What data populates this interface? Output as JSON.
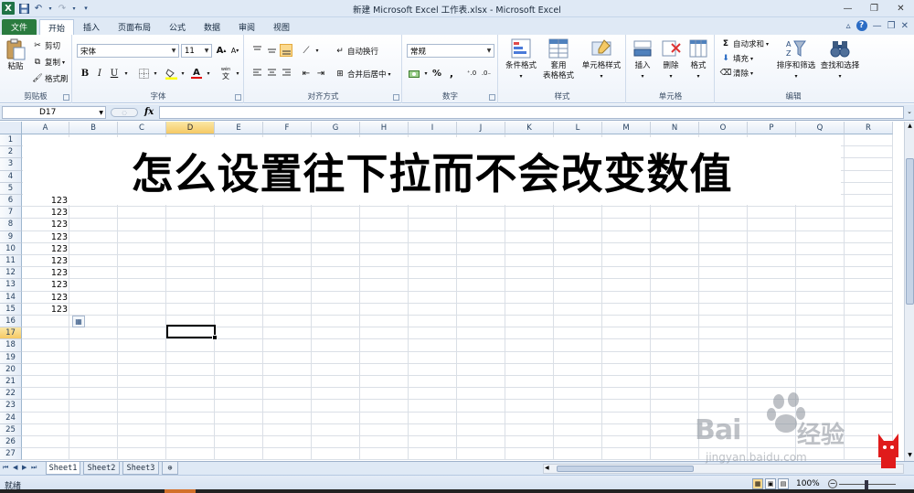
{
  "window": {
    "title": "新建 Microsoft Excel 工作表.xlsx - Microsoft Excel"
  },
  "tabs": [
    "文件",
    "开始",
    "插入",
    "页面布局",
    "公式",
    "数据",
    "审阅",
    "视图"
  ],
  "ribbon": {
    "clipboard": {
      "label": "剪贴板",
      "paste": "粘贴",
      "cut": "剪切",
      "copy": "复制",
      "format_painter": "格式刷"
    },
    "font": {
      "label": "字体",
      "name": "宋体",
      "size": "11",
      "bold": "B",
      "italic": "I",
      "underline": "U",
      "phonetic": "wén"
    },
    "alignment": {
      "label": "对齐方式",
      "wrap": "自动换行",
      "merge": "合并后居中"
    },
    "number": {
      "label": "数字",
      "format": "常规",
      "percent": "%"
    },
    "styles": {
      "label": "样式",
      "cond": "条件格式",
      "table": "套用",
      "table2": "表格格式",
      "cellstyle": "单元格样式"
    },
    "cells": {
      "label": "单元格",
      "insert": "插入",
      "delete": "删除",
      "format": "格式"
    },
    "editing": {
      "label": "编辑",
      "autosum": "自动求和",
      "fill": "填充",
      "clear": "清除",
      "sort": "排序和筛选",
      "find": "查找和选择"
    }
  },
  "formula_bar": {
    "name_box": "D17",
    "fx": "fx",
    "value": ""
  },
  "columns": [
    "A",
    "B",
    "C",
    "D",
    "E",
    "F",
    "G",
    "H",
    "I",
    "J",
    "K",
    "L",
    "M",
    "N",
    "O",
    "P",
    "Q",
    "R"
  ],
  "rows": [
    "1",
    "2",
    "3",
    "4",
    "5",
    "6",
    "7",
    "8",
    "9",
    "10",
    "11",
    "12",
    "13",
    "14",
    "15",
    "16",
    "17",
    "18",
    "19",
    "20",
    "21",
    "22",
    "23",
    "24",
    "25",
    "26",
    "27"
  ],
  "sheet_title": "怎么设置往下拉而不会改变数值",
  "cells_A": [
    "123",
    "123",
    "123",
    "123",
    "123",
    "123",
    "123",
    "123",
    "123",
    "123"
  ],
  "sheets": [
    "Sheet1",
    "Sheet2",
    "Sheet3"
  ],
  "status": {
    "ready": "就绪",
    "zoom": "100%"
  },
  "watermark": {
    "brand": "Bai",
    "brand2": "经验",
    "url": "jingyan.baidu.com"
  }
}
